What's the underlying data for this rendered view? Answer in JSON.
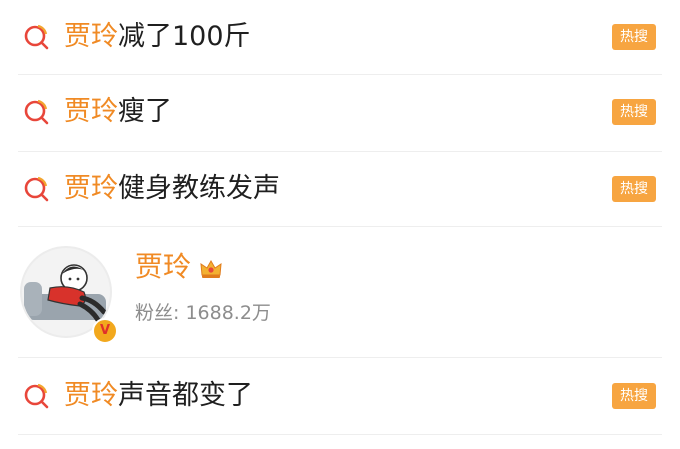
{
  "search_results": [
    {
      "keyword": "贾玲",
      "rest": "减了100斤",
      "badge": "热搜",
      "icon": "search-icon"
    },
    {
      "keyword": "贾玲",
      "rest": "瘦了",
      "badge": "热搜",
      "icon": "search-icon"
    },
    {
      "keyword": "贾玲",
      "rest": "健身教练发声",
      "badge": "热搜",
      "icon": "search-icon"
    },
    {
      "keyword": "贾玲",
      "rest": "声音都变了",
      "badge": "热搜",
      "icon": "search-icon"
    }
  ],
  "user_card": {
    "name": "贾玲",
    "fans_label": "粉丝:",
    "fans_count": "1688.2万",
    "verified_mark": "V",
    "crown_icon": "crown-icon"
  },
  "colors": {
    "keyword": "#f08a24",
    "badge_bg": "#f7a541",
    "verified": "#f2a81d",
    "icon_red": "#e8463a",
    "icon_orange": "#f3a52f"
  }
}
